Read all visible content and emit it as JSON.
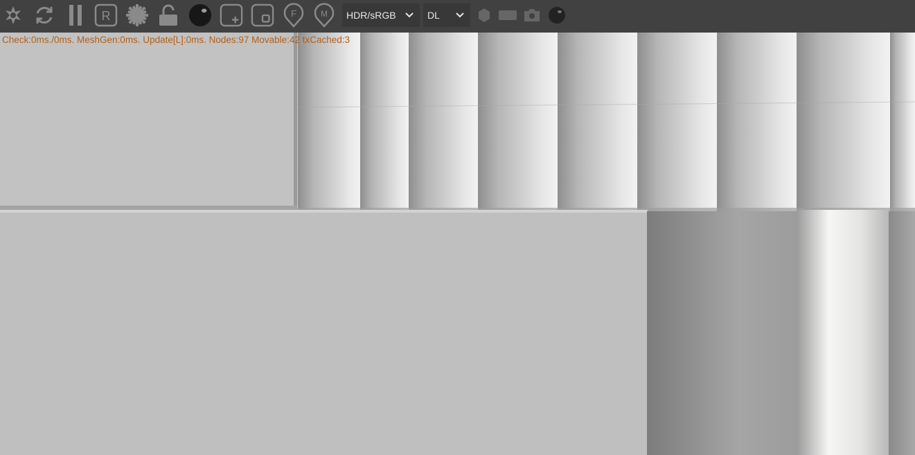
{
  "toolbar": {
    "icons": [
      "pivot-icon",
      "refresh-icon",
      "pause-icon",
      "r-mode-icon",
      "settings-gear-icon",
      "unlock-icon",
      "material-sphere-icon",
      "add-view-icon",
      "viewport-icon",
      "f-marker-icon",
      "m-marker-icon"
    ],
    "color_mode": {
      "selected": "HDR/sRGB"
    },
    "render_mode": {
      "selected": "DL"
    },
    "right_icons": [
      "light-icon",
      "rect-icon",
      "camera-icon",
      "sphere-icon"
    ]
  },
  "stats": {
    "text": "Check:0ms./0ms. MeshGen:0ms. Update[L]:0ms. Nodes:97 Movable:42 txCached:3"
  },
  "colors": {
    "toolbar_bg": "#414141",
    "icon": "#8a8a8a",
    "stats_text": "#b0601c",
    "viewport_bg": "#bdbdbd"
  }
}
